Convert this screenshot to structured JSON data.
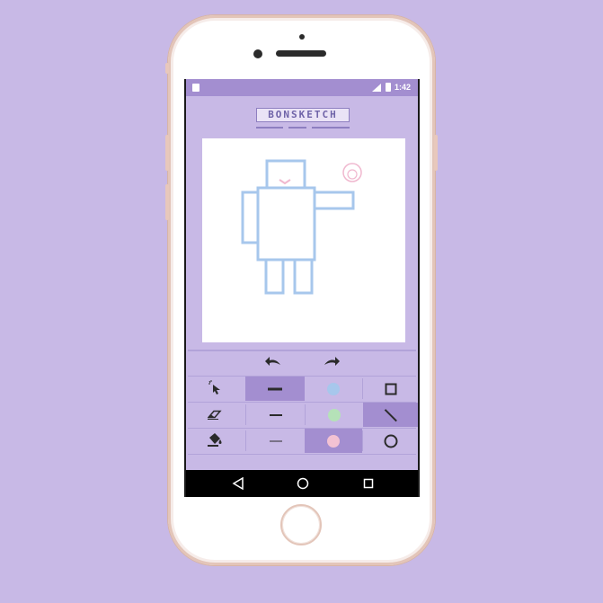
{
  "app": {
    "logo_text": "BONSKETCH"
  },
  "statusbar": {
    "time": "1:42"
  },
  "colors": {
    "background": "#c8b9e6",
    "accent": "#a38ed0",
    "selected_cell": "#a38ed0",
    "sketch_blue": "#a7c7ec",
    "sketch_pink": "#f0b8cf",
    "swatch_blue": "#a7c7ec",
    "swatch_green": "#b5e2b8",
    "swatch_pink": "#f3c2d3"
  },
  "toolbar": {
    "undo_icon": "undo-arrow-icon",
    "redo_icon": "redo-arrow-icon",
    "rows": [
      {
        "tool": "pointer-sparkle-icon",
        "stroke": "thick",
        "color": "blue",
        "shape": "square"
      },
      {
        "tool": "eraser-icon",
        "stroke": "medium",
        "color": "green",
        "shape": "line"
      },
      {
        "tool": "paint-bucket-icon",
        "stroke": "thin",
        "color": "pink",
        "shape": "circle"
      }
    ],
    "selected": {
      "stroke": "thick",
      "color": "pink",
      "shape": "line"
    }
  },
  "navbar": {
    "back_icon": "back-triangle-icon",
    "home_icon": "home-circle-icon",
    "recents_icon": "recents-square-icon"
  }
}
